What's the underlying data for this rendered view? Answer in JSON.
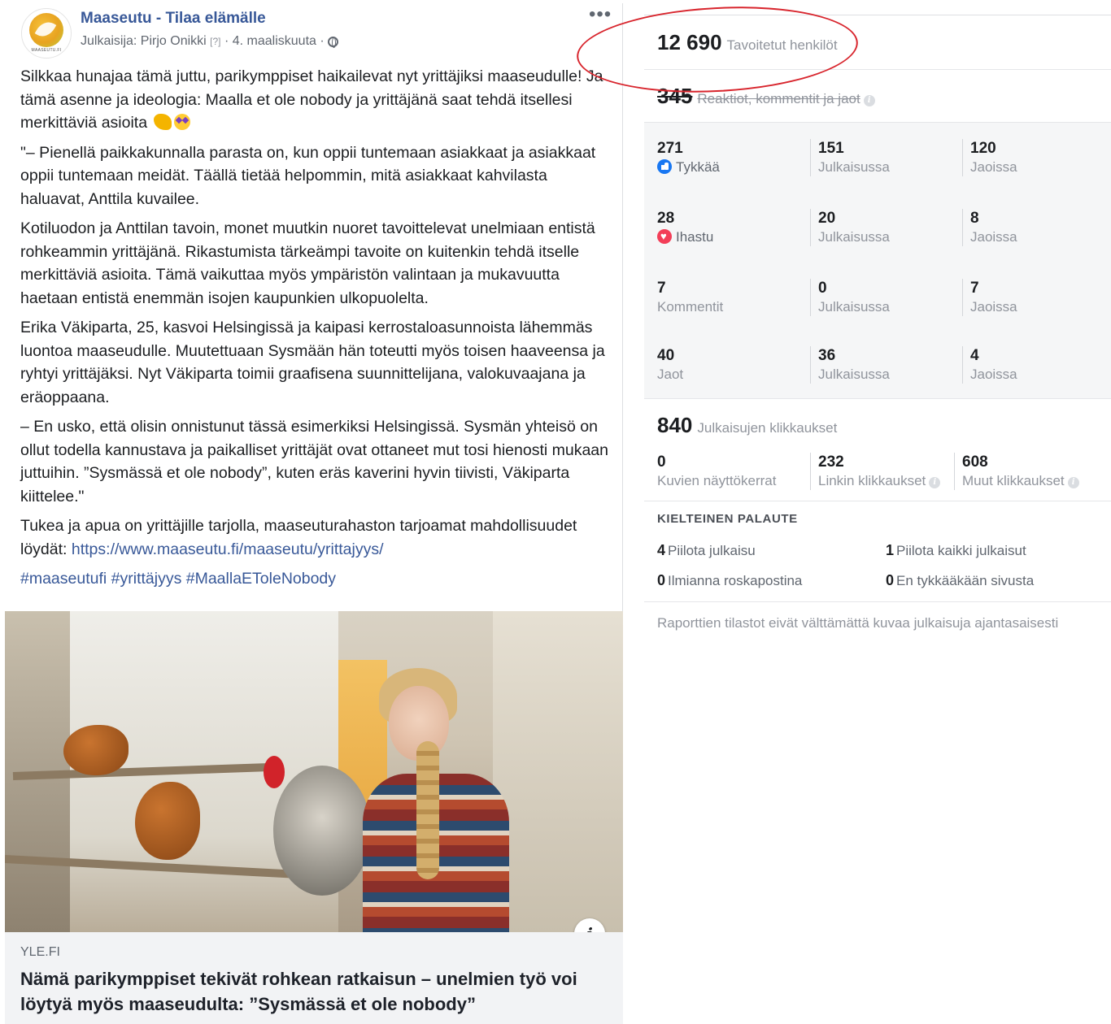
{
  "post": {
    "page_name": "Maaseutu - Tilaa elämälle",
    "avatar_brand": "MAASEUTU.FI",
    "meta": {
      "publisher": "Julkaisija: Pirjo Onikki",
      "help_mark": "[?]",
      "separator": "·",
      "date": "4. maaliskuuta",
      "separator2": "·"
    },
    "more_label": "•••",
    "paragraphs": [
      "Silkkaa hunajaa tämä juttu, parikymppiset haikailevat nyt yrittäjiksi maaseudulle! Ja tämä asenne ja ideologia: Maalla et ole nobody ja yrittäjänä saat tehdä itsellesi merkittäviä asioita",
      "\"– Pienellä paikkakunnalla parasta on, kun oppii tuntemaan asiakkaat ja asiakkaat oppii tuntemaan meidät. Täällä tietää helpommin, mitä asiakkaat kahvilasta haluavat, Anttila kuvailee.",
      "Kotiluodon ja Anttilan tavoin, monet muutkin nuoret tavoittelevat unelmiaan entistä rohkeammin yrittäjänä. Rikastumista tärkeämpi tavoite on kuitenkin tehdä itselle merkittäviä asioita. Tämä vaikuttaa myös ympäristön valintaan ja mukavuutta haetaan entistä enemmän isojen kaupunkien ulkopuolelta.",
      "Erika Väkiparta, 25, kasvoi Helsingissä ja kaipasi kerrostaloasunnoista lähemmäs luontoa maaseudulle. Muutettuaan Sysmään hän toteutti myös toisen haaveensa ja ryhtyi yrittäjäksi. Nyt Väkiparta toimii graafisena suunnittelijana, valokuvaajana ja eräoppaana.",
      "– En usko, että olisin onnistunut tässä esimerkiksi Helsingissä. Sysmän yhteisö on ollut todella kannustava ja paikalliset yrittäjät ovat ottaneet mut tosi hienosti mukaan juttuihin. ”Sysmässä et ole nobody”, kuten eräs kaverini hyvin tiivisti, Väkiparta kiittelee.\""
    ],
    "support_text": "Tukea ja apua on yrittäjille tarjolla, maaseuturahaston tarjoamat mahdollisuudet löydät:",
    "support_link": "https://www.maaseutu.fi/maaseutu/yrittajyys/",
    "hashtags": "#maaseutufi #yrittäjyys #MaallaEToleNobody",
    "link_preview": {
      "info_label": "i",
      "domain": "YLE.FI",
      "title": "Nämä parikymppiset tekivät rohkean ratkaisun – unelmien työ voi löytyä myös maaseudulta: ”Sysmässä et ole nobody”"
    }
  },
  "insights": {
    "reach": {
      "value": "12 690",
      "label": "Tavoitetut henkilöt"
    },
    "engagement": {
      "value": "345",
      "label": "Reaktiot, kommentit ja jaot",
      "info": "i"
    },
    "rows": [
      {
        "total": "271",
        "label": "Tykkää",
        "icon": "like-icon",
        "on_post": "151",
        "on_post_label": "Julkaisussa",
        "shares": "120",
        "shares_label": "Jaoissa"
      },
      {
        "total": "28",
        "label": "Ihastu",
        "icon": "heart-icon",
        "on_post": "20",
        "on_post_label": "Julkaisussa",
        "shares": "8",
        "shares_label": "Jaoissa"
      },
      {
        "total": "7",
        "label": "Kommentit",
        "on_post": "0",
        "on_post_label": "Julkaisussa",
        "shares": "7",
        "shares_label": "Jaoissa"
      },
      {
        "total": "40",
        "label": "Jaot",
        "on_post": "36",
        "on_post_label": "Julkaisussa",
        "shares": "4",
        "shares_label": "Jaoissa"
      }
    ],
    "clicks": {
      "value": "840",
      "label": "Julkaisujen klikkaukset"
    },
    "click_breakdown": [
      {
        "value": "0",
        "label": "Kuvien näyttökerrat"
      },
      {
        "value": "232",
        "label": "Linkin klikkaukset",
        "info": "i"
      },
      {
        "value": "608",
        "label": "Muut klikkaukset",
        "info": "i"
      }
    ],
    "negative_title": "KIELTEINEN PALAUTE",
    "negative": [
      {
        "value": "4",
        "label": "Piilota julkaisu"
      },
      {
        "value": "1",
        "label": "Piilota kaikki julkaisut"
      },
      {
        "value": "0",
        "label": "Ilmianna roskapostina"
      },
      {
        "value": "0",
        "label": "En tykkääkään sivusta"
      }
    ],
    "disclaimer": "Raporttien tilastot eivät välttämättä kuvaa julkaisuja ajantasaisesti"
  },
  "colors": {
    "link_blue": "#385898",
    "annotation_red": "#d8252d",
    "like_blue": "#1877f2",
    "heart_red": "#f33e58"
  }
}
